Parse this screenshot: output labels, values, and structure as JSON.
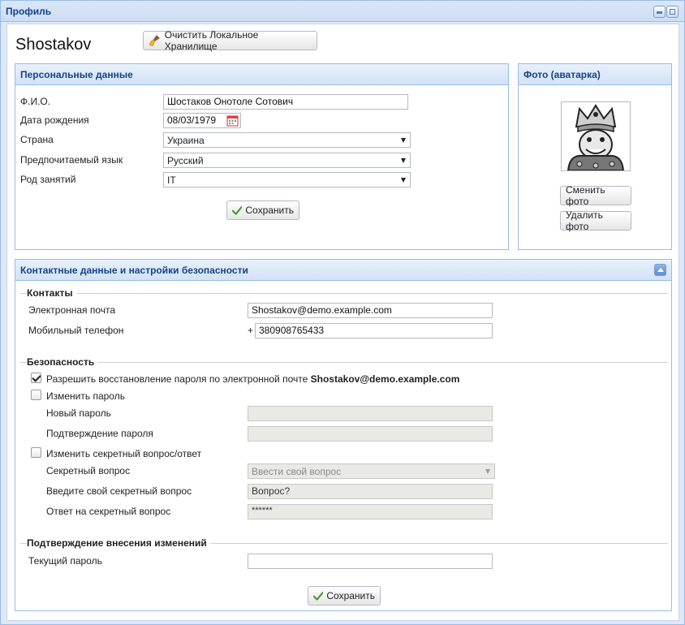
{
  "window": {
    "title": "Профиль"
  },
  "header": {
    "username": "Shostakov",
    "clear_storage_label": "Очистить Локальное Хранилище"
  },
  "personal": {
    "title": "Персональные данные",
    "fio_label": "Ф.И.О.",
    "fio_value": "Шостаков Онотоле Сотович",
    "birth_label": "Дата рождения",
    "birth_value": "08/03/1979",
    "country_label": "Страна",
    "country_value": "Украина",
    "lang_label": "Предпочитаемый язык",
    "lang_value": "Русский",
    "occupation_label": "Род занятий",
    "occupation_value": "IT",
    "save_label": "Сохранить"
  },
  "photo": {
    "title": "Фото (аватарка)",
    "change_label": "Сменить фото",
    "delete_label": "Удалить фото"
  },
  "contacts": {
    "title": "Контактные данные и настройки безопасности",
    "contacts_legend": "Контакты",
    "email_label": "Электронная почта",
    "email_value": "Shostakov@demo.example.com",
    "phone_label": "Мобильный телефон",
    "phone_prefix": "+",
    "phone_value": "380908765433",
    "security_legend": "Безопасность",
    "allow_recovery_label": "Разрешить восстановление пароля по электронной почте",
    "allow_recovery_email": "Shostakov@demo.example.com",
    "allow_recovery_checked": true,
    "change_password_label": "Изменить пароль",
    "change_password_checked": false,
    "new_password_label": "Новый пароль",
    "confirm_password_label": "Подтверждение пароля",
    "change_secret_label": "Изменить секретный вопрос/ответ",
    "change_secret_checked": false,
    "secret_question_label": "Секретный вопрос",
    "secret_question_value": "Ввести свой вопрос",
    "own_question_label": "Введите свой секретный вопрос",
    "own_question_value": "Вопрос?",
    "secret_answer_label": "Ответ на секретный вопрос",
    "secret_answer_value": "******",
    "confirm_legend": "Подтверждение внесения изменений",
    "current_password_label": "Текущий пароль",
    "save_label": "Сохранить"
  },
  "colors": {
    "panel_border": "#99bbe8",
    "header_text": "#15428b",
    "check_green": "#3a9a2a"
  }
}
